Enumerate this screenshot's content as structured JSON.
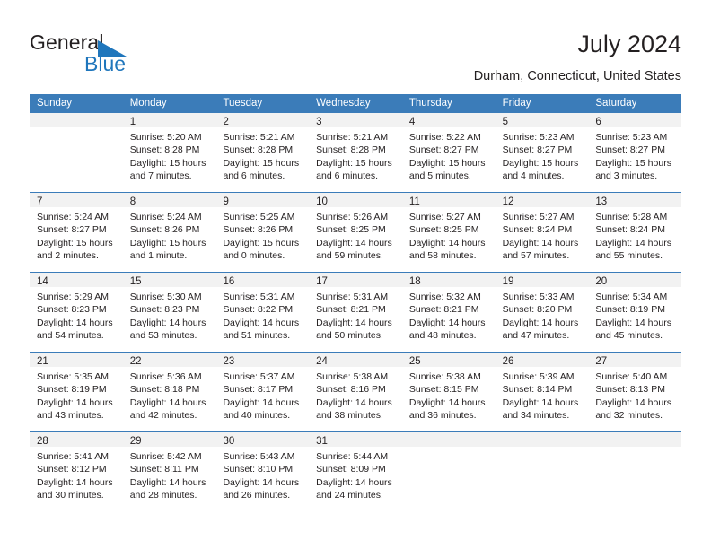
{
  "brand": {
    "word_one": "General",
    "word_two": "Blue",
    "mark_icon": "triangle-flag-icon",
    "accent_color": "#1f76bc"
  },
  "header": {
    "title": "July 2024",
    "location": "Durham, Connecticut, United States"
  },
  "calendar": {
    "header_color": "#3b7cb9",
    "day_band_color": "#f2f2f2",
    "weekdays": [
      "Sunday",
      "Monday",
      "Tuesday",
      "Wednesday",
      "Thursday",
      "Friday",
      "Saturday"
    ],
    "weeks": [
      [
        {
          "day": "",
          "empty": true,
          "sunrise": "",
          "sunset": "",
          "daylight_line1": "",
          "daylight_line2": ""
        },
        {
          "day": "1",
          "sunrise": "Sunrise: 5:20 AM",
          "sunset": "Sunset: 8:28 PM",
          "daylight_line1": "Daylight: 15 hours",
          "daylight_line2": "and 7 minutes."
        },
        {
          "day": "2",
          "sunrise": "Sunrise: 5:21 AM",
          "sunset": "Sunset: 8:28 PM",
          "daylight_line1": "Daylight: 15 hours",
          "daylight_line2": "and 6 minutes."
        },
        {
          "day": "3",
          "sunrise": "Sunrise: 5:21 AM",
          "sunset": "Sunset: 8:28 PM",
          "daylight_line1": "Daylight: 15 hours",
          "daylight_line2": "and 6 minutes."
        },
        {
          "day": "4",
          "sunrise": "Sunrise: 5:22 AM",
          "sunset": "Sunset: 8:27 PM",
          "daylight_line1": "Daylight: 15 hours",
          "daylight_line2": "and 5 minutes."
        },
        {
          "day": "5",
          "sunrise": "Sunrise: 5:23 AM",
          "sunset": "Sunset: 8:27 PM",
          "daylight_line1": "Daylight: 15 hours",
          "daylight_line2": "and 4 minutes."
        },
        {
          "day": "6",
          "sunrise": "Sunrise: 5:23 AM",
          "sunset": "Sunset: 8:27 PM",
          "daylight_line1": "Daylight: 15 hours",
          "daylight_line2": "and 3 minutes."
        }
      ],
      [
        {
          "day": "7",
          "sunrise": "Sunrise: 5:24 AM",
          "sunset": "Sunset: 8:27 PM",
          "daylight_line1": "Daylight: 15 hours",
          "daylight_line2": "and 2 minutes."
        },
        {
          "day": "8",
          "sunrise": "Sunrise: 5:24 AM",
          "sunset": "Sunset: 8:26 PM",
          "daylight_line1": "Daylight: 15 hours",
          "daylight_line2": "and 1 minute."
        },
        {
          "day": "9",
          "sunrise": "Sunrise: 5:25 AM",
          "sunset": "Sunset: 8:26 PM",
          "daylight_line1": "Daylight: 15 hours",
          "daylight_line2": "and 0 minutes."
        },
        {
          "day": "10",
          "sunrise": "Sunrise: 5:26 AM",
          "sunset": "Sunset: 8:25 PM",
          "daylight_line1": "Daylight: 14 hours",
          "daylight_line2": "and 59 minutes."
        },
        {
          "day": "11",
          "sunrise": "Sunrise: 5:27 AM",
          "sunset": "Sunset: 8:25 PM",
          "daylight_line1": "Daylight: 14 hours",
          "daylight_line2": "and 58 minutes."
        },
        {
          "day": "12",
          "sunrise": "Sunrise: 5:27 AM",
          "sunset": "Sunset: 8:24 PM",
          "daylight_line1": "Daylight: 14 hours",
          "daylight_line2": "and 57 minutes."
        },
        {
          "day": "13",
          "sunrise": "Sunrise: 5:28 AM",
          "sunset": "Sunset: 8:24 PM",
          "daylight_line1": "Daylight: 14 hours",
          "daylight_line2": "and 55 minutes."
        }
      ],
      [
        {
          "day": "14",
          "sunrise": "Sunrise: 5:29 AM",
          "sunset": "Sunset: 8:23 PM",
          "daylight_line1": "Daylight: 14 hours",
          "daylight_line2": "and 54 minutes."
        },
        {
          "day": "15",
          "sunrise": "Sunrise: 5:30 AM",
          "sunset": "Sunset: 8:23 PM",
          "daylight_line1": "Daylight: 14 hours",
          "daylight_line2": "and 53 minutes."
        },
        {
          "day": "16",
          "sunrise": "Sunrise: 5:31 AM",
          "sunset": "Sunset: 8:22 PM",
          "daylight_line1": "Daylight: 14 hours",
          "daylight_line2": "and 51 minutes."
        },
        {
          "day": "17",
          "sunrise": "Sunrise: 5:31 AM",
          "sunset": "Sunset: 8:21 PM",
          "daylight_line1": "Daylight: 14 hours",
          "daylight_line2": "and 50 minutes."
        },
        {
          "day": "18",
          "sunrise": "Sunrise: 5:32 AM",
          "sunset": "Sunset: 8:21 PM",
          "daylight_line1": "Daylight: 14 hours",
          "daylight_line2": "and 48 minutes."
        },
        {
          "day": "19",
          "sunrise": "Sunrise: 5:33 AM",
          "sunset": "Sunset: 8:20 PM",
          "daylight_line1": "Daylight: 14 hours",
          "daylight_line2": "and 47 minutes."
        },
        {
          "day": "20",
          "sunrise": "Sunrise: 5:34 AM",
          "sunset": "Sunset: 8:19 PM",
          "daylight_line1": "Daylight: 14 hours",
          "daylight_line2": "and 45 minutes."
        }
      ],
      [
        {
          "day": "21",
          "sunrise": "Sunrise: 5:35 AM",
          "sunset": "Sunset: 8:19 PM",
          "daylight_line1": "Daylight: 14 hours",
          "daylight_line2": "and 43 minutes."
        },
        {
          "day": "22",
          "sunrise": "Sunrise: 5:36 AM",
          "sunset": "Sunset: 8:18 PM",
          "daylight_line1": "Daylight: 14 hours",
          "daylight_line2": "and 42 minutes."
        },
        {
          "day": "23",
          "sunrise": "Sunrise: 5:37 AM",
          "sunset": "Sunset: 8:17 PM",
          "daylight_line1": "Daylight: 14 hours",
          "daylight_line2": "and 40 minutes."
        },
        {
          "day": "24",
          "sunrise": "Sunrise: 5:38 AM",
          "sunset": "Sunset: 8:16 PM",
          "daylight_line1": "Daylight: 14 hours",
          "daylight_line2": "and 38 minutes."
        },
        {
          "day": "25",
          "sunrise": "Sunrise: 5:38 AM",
          "sunset": "Sunset: 8:15 PM",
          "daylight_line1": "Daylight: 14 hours",
          "daylight_line2": "and 36 minutes."
        },
        {
          "day": "26",
          "sunrise": "Sunrise: 5:39 AM",
          "sunset": "Sunset: 8:14 PM",
          "daylight_line1": "Daylight: 14 hours",
          "daylight_line2": "and 34 minutes."
        },
        {
          "day": "27",
          "sunrise": "Sunrise: 5:40 AM",
          "sunset": "Sunset: 8:13 PM",
          "daylight_line1": "Daylight: 14 hours",
          "daylight_line2": "and 32 minutes."
        }
      ],
      [
        {
          "day": "28",
          "sunrise": "Sunrise: 5:41 AM",
          "sunset": "Sunset: 8:12 PM",
          "daylight_line1": "Daylight: 14 hours",
          "daylight_line2": "and 30 minutes."
        },
        {
          "day": "29",
          "sunrise": "Sunrise: 5:42 AM",
          "sunset": "Sunset: 8:11 PM",
          "daylight_line1": "Daylight: 14 hours",
          "daylight_line2": "and 28 minutes."
        },
        {
          "day": "30",
          "sunrise": "Sunrise: 5:43 AM",
          "sunset": "Sunset: 8:10 PM",
          "daylight_line1": "Daylight: 14 hours",
          "daylight_line2": "and 26 minutes."
        },
        {
          "day": "31",
          "sunrise": "Sunrise: 5:44 AM",
          "sunset": "Sunset: 8:09 PM",
          "daylight_line1": "Daylight: 14 hours",
          "daylight_line2": "and 24 minutes."
        },
        {
          "day": "",
          "empty": true,
          "sunrise": "",
          "sunset": "",
          "daylight_line1": "",
          "daylight_line2": ""
        },
        {
          "day": "",
          "empty": true,
          "sunrise": "",
          "sunset": "",
          "daylight_line1": "",
          "daylight_line2": ""
        },
        {
          "day": "",
          "empty": true,
          "sunrise": "",
          "sunset": "",
          "daylight_line1": "",
          "daylight_line2": ""
        }
      ]
    ]
  }
}
